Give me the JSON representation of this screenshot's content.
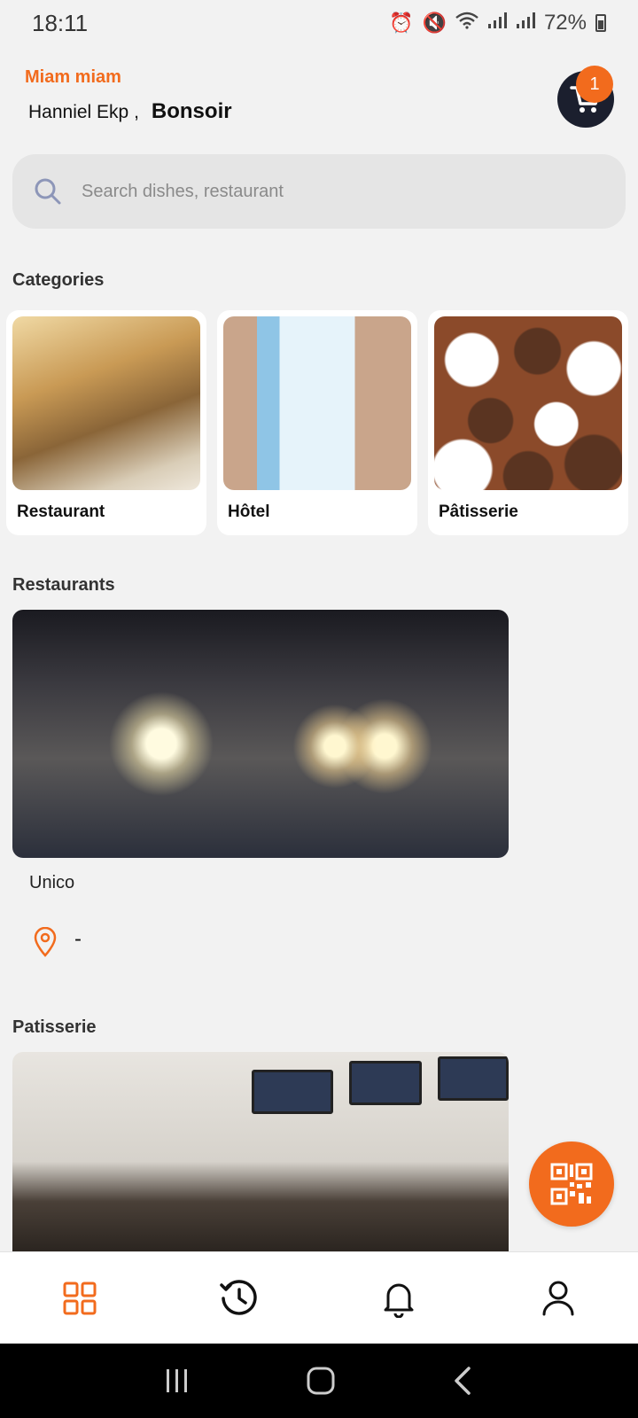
{
  "status_bar": {
    "time": "18:11",
    "battery": "72%",
    "icons": [
      "alarm-icon",
      "mute-icon",
      "wifi-icon",
      "signal-icon",
      "signal-icon",
      "battery-icon"
    ]
  },
  "header": {
    "brand": "Miam miam",
    "user_name": "Hanniel Ekp ,",
    "greeting": "Bonsoir",
    "cart_count": "1"
  },
  "search": {
    "placeholder": "Search dishes, restaurant"
  },
  "categories": {
    "title": "Categories",
    "items": [
      {
        "label": "Restaurant"
      },
      {
        "label": "Hôtel"
      },
      {
        "label": "Pâtisserie"
      }
    ]
  },
  "restaurants": {
    "title": "Restaurants",
    "items": [
      {
        "name": "Unico",
        "location": "-"
      }
    ]
  },
  "patisserie": {
    "title": "Patisserie"
  },
  "bottom_nav": {
    "items": [
      "home-grid-icon",
      "history-icon",
      "bell-icon",
      "profile-icon"
    ],
    "active": "home-grid-icon"
  },
  "colors": {
    "accent": "#f26b1d",
    "cart_bg": "#1b1f2e",
    "background": "#f2f2f2"
  }
}
